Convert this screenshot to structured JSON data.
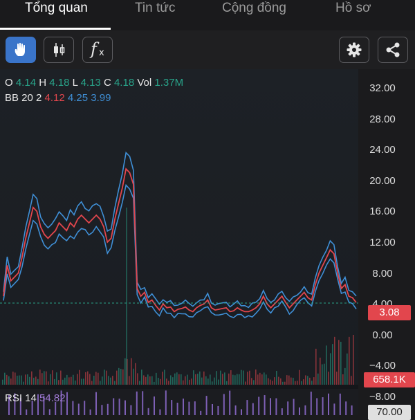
{
  "tabs": [
    {
      "label": "Tổng quan",
      "active": true
    },
    {
      "label": "Tin tức",
      "active": false
    },
    {
      "label": "Cộng đồng",
      "active": false
    },
    {
      "label": "Hồ sơ",
      "active": false
    }
  ],
  "toolbar": {
    "buttons": [
      {
        "icon": "hand-pointer-icon",
        "active": true
      },
      {
        "icon": "candlestick-icon",
        "active": false
      },
      {
        "icon": "function-icon",
        "active": false,
        "glyph": "f",
        "subglyph": "x"
      },
      {
        "icon": "gear-icon",
        "active": false
      },
      {
        "icon": "share-icon",
        "active": false
      }
    ]
  },
  "ohlc": {
    "o_label": "O",
    "o_value": "4.14",
    "h_label": "H",
    "h_value": "4.18",
    "l_label": "L",
    "l_value": "4.13",
    "c_label": "C",
    "c_value": "4.18",
    "vol_label": "Vol",
    "vol_value": "1.37M"
  },
  "bb": {
    "label": "BB 20 2",
    "middle": "4.12",
    "upper": "4.25",
    "lower": "3.99"
  },
  "rsi": {
    "label": "RSI 14",
    "value": "54.82"
  },
  "axis_labels": [
    "32.00",
    "28.00",
    "24.00",
    "20.00",
    "16.00",
    "12.00",
    "8.00",
    "4.00",
    "0.00",
    "−4.00",
    "−8.00"
  ],
  "tags": {
    "price": "3.08",
    "volume": "658.1K",
    "rsi": "70.00"
  },
  "colors": {
    "up": "#29a48a",
    "down": "#e2464d",
    "bb_band": "#3f8fd6",
    "rsi": "#8f6cd0",
    "active_button": "#3a74c9",
    "price_line": "#29a48a"
  },
  "chart_data": {
    "type": "line",
    "series": [
      {
        "name": "BB middle",
        "values": [
          5.0,
          9.0,
          7.0,
          7.5,
          8.0,
          10.0,
          12.5,
          14.5,
          16.5,
          16.0,
          14.0,
          13.0,
          12.5,
          13.0,
          13.5,
          14.5,
          14.0,
          13.5,
          14.5,
          14.0,
          15.0,
          15.5,
          15.0,
          14.5,
          15.0,
          15.5,
          15.0,
          14.0,
          12.0,
          12.5,
          15.0,
          17.0,
          19.0,
          21.5,
          21.0,
          19.5,
          6.0,
          5.0,
          5.5,
          4.2,
          4.5,
          3.8,
          3.2,
          4.0,
          3.5,
          3.6,
          3.0,
          3.3,
          3.4,
          3.6,
          3.2,
          3.0,
          3.5,
          3.8,
          4.0,
          4.5,
          3.5,
          3.2,
          3.3,
          3.4,
          3.5,
          3.0,
          3.1,
          3.5,
          3.2,
          3.0,
          3.0,
          3.2,
          3.5,
          4.0,
          5.0,
          4.0,
          3.5,
          4.0,
          4.5,
          5.0,
          4.2,
          3.5,
          4.0,
          4.5,
          5.0,
          5.5,
          4.8,
          4.5,
          6.5,
          8.0,
          9.0,
          10.0,
          11.0,
          10.5,
          8.0,
          6.0,
          6.5,
          5.0,
          4.8,
          4.18
        ]
      }
    ],
    "ylim": [
      -8,
      32
    ]
  }
}
